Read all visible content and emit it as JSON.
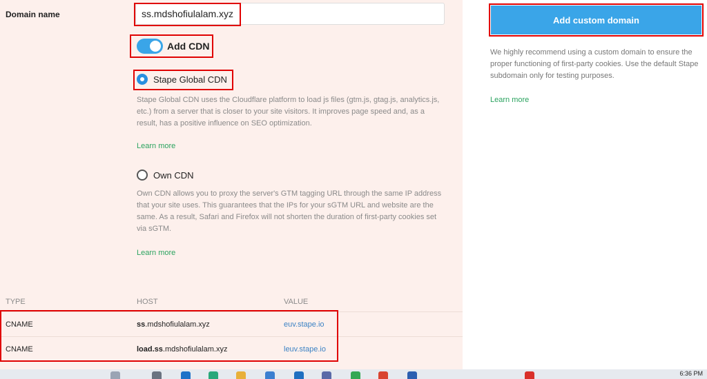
{
  "form": {
    "domain_label": "Domain name",
    "domain_value": "ss.mdshofiulalam.xyz",
    "cdn_toggle_label": "Add CDN",
    "options": [
      {
        "label": "Stape Global CDN",
        "selected": true,
        "description": "Stape Global CDN uses the Cloudflare platform to load js files (gtm.js, gtag.js, analytics.js, etc.) from a server that is closer to your site visitors. It improves page speed and, as a result, has a positive influence on SEO optimization.",
        "learn_more": "Learn more"
      },
      {
        "label": "Own CDN",
        "selected": false,
        "description": "Own CDN allows you to proxy the server's GTM tagging URL through the same IP address that your site uses. This guarantees that the IPs for your sGTM URL and website are the same. As a result, Safari and Firefox will not shorten the duration of first-party cookies set via sGTM.",
        "learn_more": "Learn more"
      }
    ]
  },
  "dns_table": {
    "headers": [
      "TYPE",
      "HOST",
      "VALUE"
    ],
    "rows": [
      {
        "type": "CNAME",
        "host_bold": "ss",
        "host_rest": ".mdshofiulalam.xyz",
        "value": "euv.stape.io"
      },
      {
        "type": "CNAME",
        "host_bold": "load.ss",
        "host_rest": ".mdshofiulalam.xyz",
        "value": "leuv.stape.io"
      }
    ]
  },
  "sidebar": {
    "button_label": "Add custom domain",
    "description": "We highly recommend using a custom domain to ensure the proper functioning of first-party cookies. Use the default Stape subdomain only for testing purposes.",
    "learn_more": "Learn more"
  },
  "taskbar": {
    "time": "6:36 PM"
  },
  "colors": {
    "accent": "#3aa5e8",
    "link_green": "#2ba35f",
    "link_blue": "#3b82c4",
    "highlight_red": "#e00000"
  }
}
